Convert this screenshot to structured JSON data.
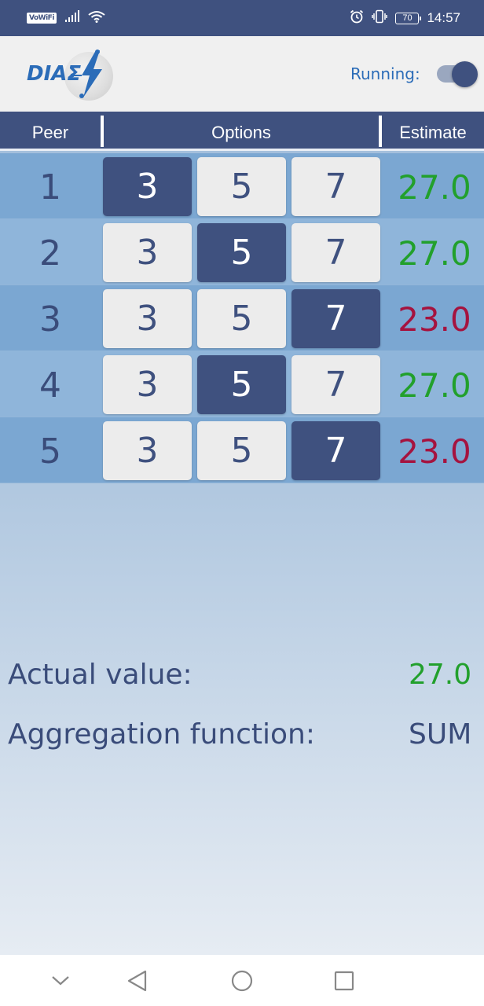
{
  "status_bar": {
    "vowifi": "VoWiFi",
    "battery": "70",
    "time": "14:57",
    "icons": [
      "signal-icon",
      "wifi-icon",
      "alarm-icon",
      "vibrate-icon",
      "battery-icon"
    ]
  },
  "app_bar": {
    "logo_text": "DIAΣ",
    "running_label": "Running:",
    "running_on": true
  },
  "table": {
    "headers": {
      "peer": "Peer",
      "options": "Options",
      "estimate": "Estimate"
    },
    "rows": [
      {
        "peer": "1",
        "options": [
          "3",
          "5",
          "7"
        ],
        "selected": 0,
        "estimate": "27.0",
        "estimate_color": "#22a02c"
      },
      {
        "peer": "2",
        "options": [
          "3",
          "5",
          "7"
        ],
        "selected": 1,
        "estimate": "27.0",
        "estimate_color": "#22a02c"
      },
      {
        "peer": "3",
        "options": [
          "3",
          "5",
          "7"
        ],
        "selected": 2,
        "estimate": "23.0",
        "estimate_color": "#a5133f"
      },
      {
        "peer": "4",
        "options": [
          "3",
          "5",
          "7"
        ],
        "selected": 1,
        "estimate": "27.0",
        "estimate_color": "#22a02c"
      },
      {
        "peer": "5",
        "options": [
          "3",
          "5",
          "7"
        ],
        "selected": 2,
        "estimate": "23.0",
        "estimate_color": "#a5133f"
      }
    ]
  },
  "info": {
    "actual_label": "Actual value:",
    "actual_value": "27.0",
    "aggregation_label": "Aggregation function:",
    "aggregation_value": "SUM"
  },
  "colors": {
    "primary": "#3f517f",
    "accent_blue": "#2b6cb8",
    "green": "#22a02c",
    "red": "#a5133f"
  },
  "nav_bar": {
    "icons": [
      "chevron-down-icon",
      "back-icon",
      "home-icon",
      "recent-apps-icon"
    ]
  }
}
